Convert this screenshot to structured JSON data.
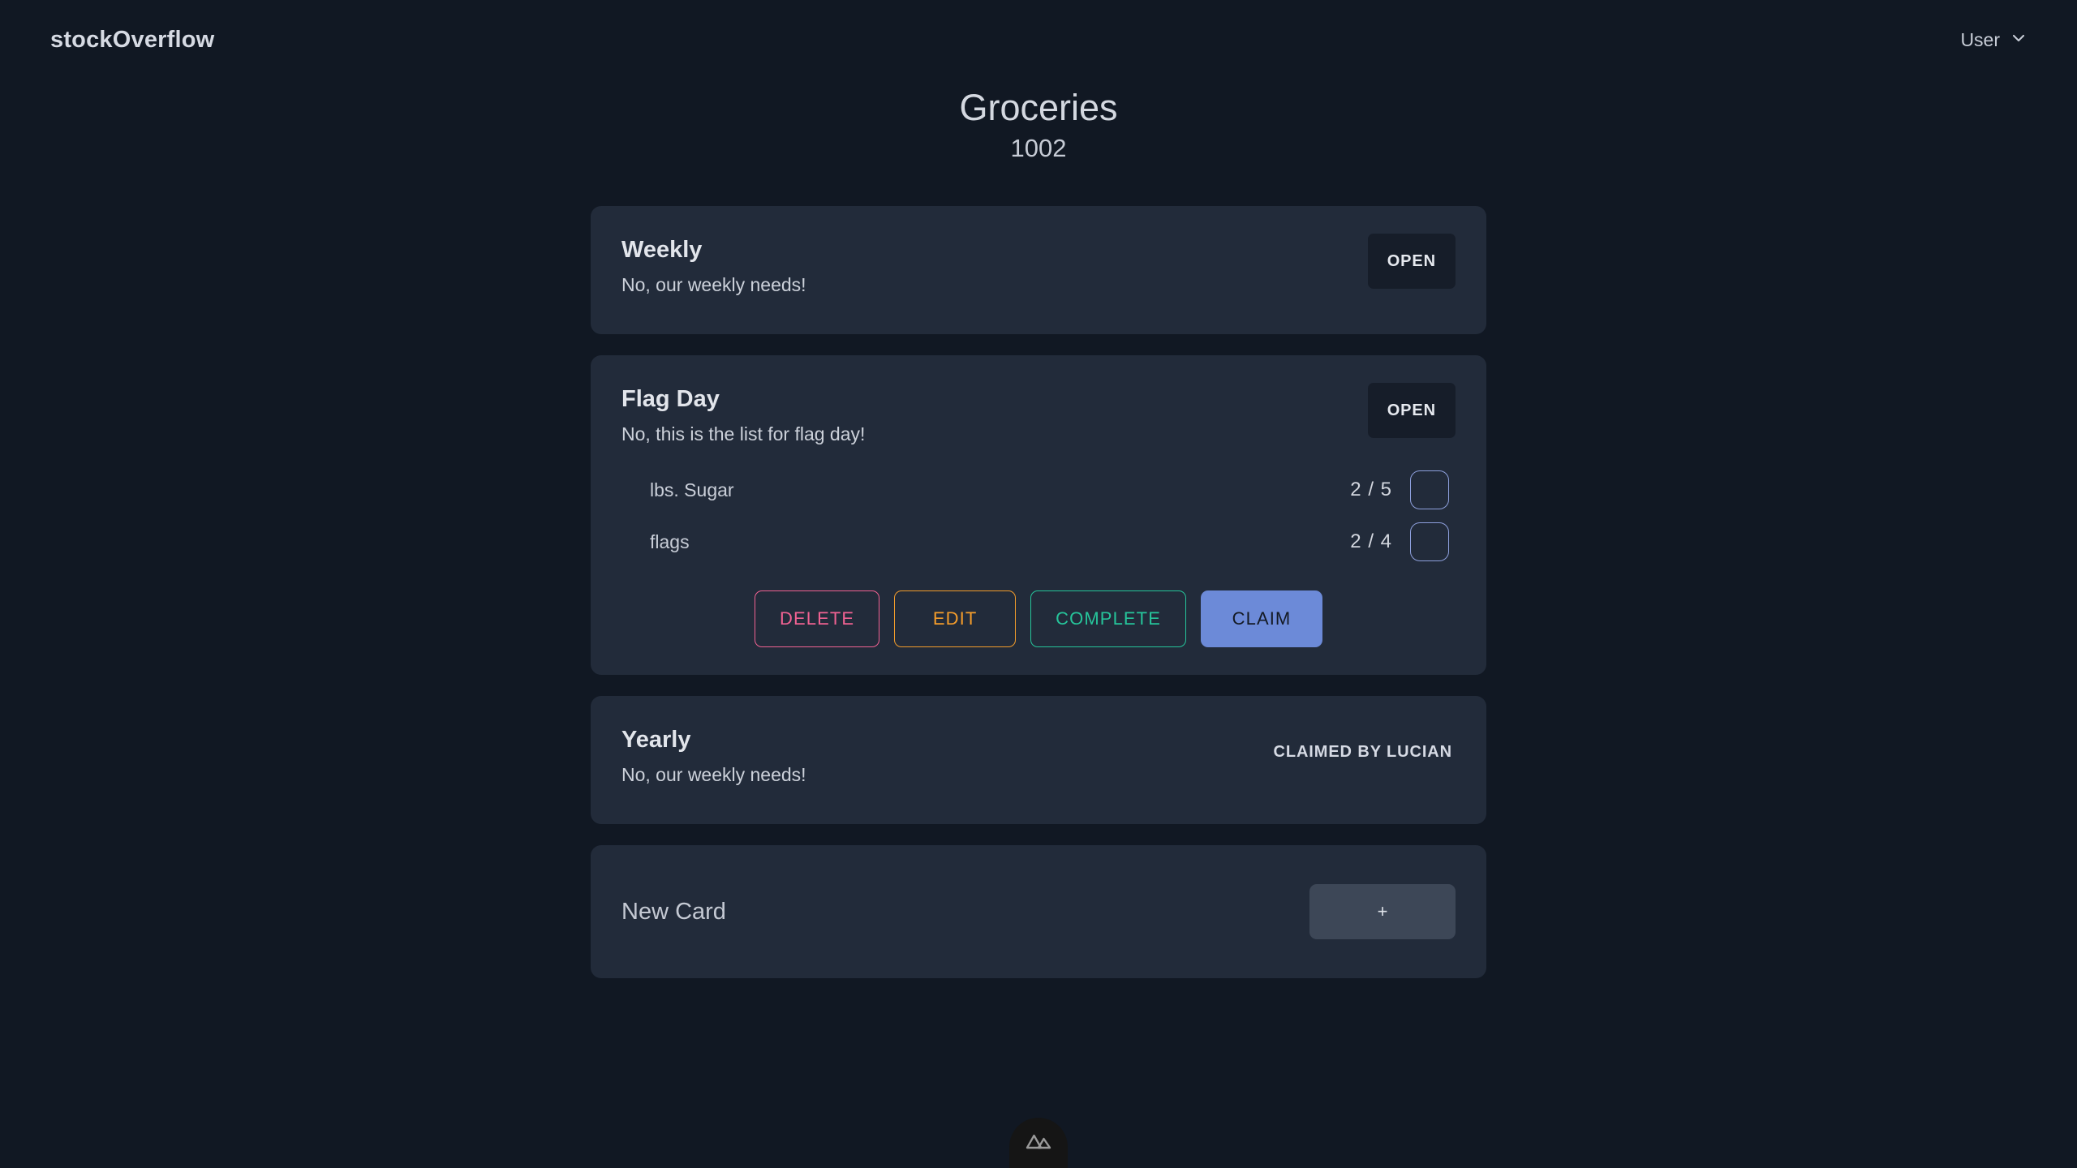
{
  "topbar": {
    "brand": "stockOverflow",
    "user_label": "User",
    "chevron_icon": "chevron-down-icon"
  },
  "page": {
    "title": "Groceries",
    "subtitle": "1002"
  },
  "colors": {
    "background": "#111823",
    "card": "#222b3a",
    "open_button": "#161d29",
    "delete": "#f06292",
    "edit": "#f39c2b",
    "complete": "#26c49a",
    "claim": "#6c8ad8",
    "checkbox_border": "#8ea0dd",
    "plus_button": "#3d4757"
  },
  "cards": [
    {
      "title": "Weekly",
      "description": "No, our weekly needs!",
      "action_label": "OPEN"
    },
    {
      "title": "Flag Day",
      "description": "No, this is the list for flag day!",
      "action_label": "OPEN",
      "items": [
        {
          "name": "lbs. Sugar",
          "count": "2 / 5",
          "checked": false
        },
        {
          "name": "flags",
          "count": "2 / 4",
          "checked": false
        }
      ],
      "actions": [
        {
          "label": "DELETE"
        },
        {
          "label": "EDIT"
        },
        {
          "label": "COMPLETE"
        },
        {
          "label": "CLAIM"
        }
      ]
    },
    {
      "title": "Yearly",
      "description": "No, our weekly needs!",
      "claimed_label": "CLAIMED BY LUCIAN"
    }
  ],
  "new_card": {
    "title": "New Card",
    "add_label": "+"
  },
  "footer": {
    "badge_icon": "mountain-logo-icon"
  }
}
